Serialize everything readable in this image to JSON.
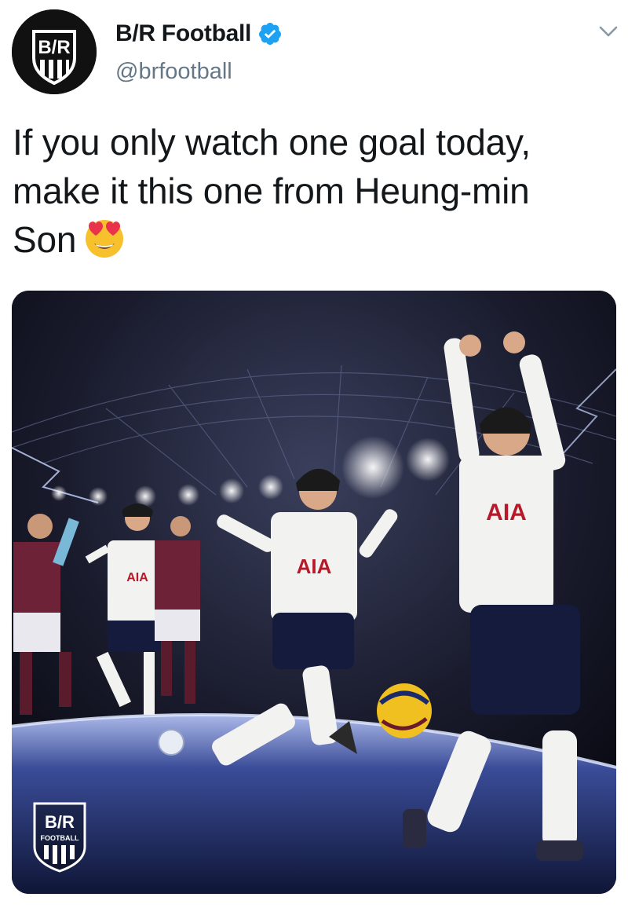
{
  "tweet": {
    "author": {
      "display_name": "B/R Football",
      "handle": "@brfootball",
      "avatar_logo_text": "B/R",
      "verified_icon": "verified-badge-icon",
      "verified_color": "#1da1f2"
    },
    "menu_icon": "chevron-down-icon",
    "text_lines": [
      "If you only watch one goal today,",
      "make it this one from Heung-min",
      "Son"
    ],
    "emoji": "smiling-face-with-heart-eyes",
    "media": {
      "watermark_logo": "B/R",
      "watermark_sub": "FOOTBALL",
      "shirt_sponsor": "AIA"
    }
  },
  "colors": {
    "text": "#14171a",
    "secondary": "#657786",
    "accent": "#1da1f2"
  }
}
